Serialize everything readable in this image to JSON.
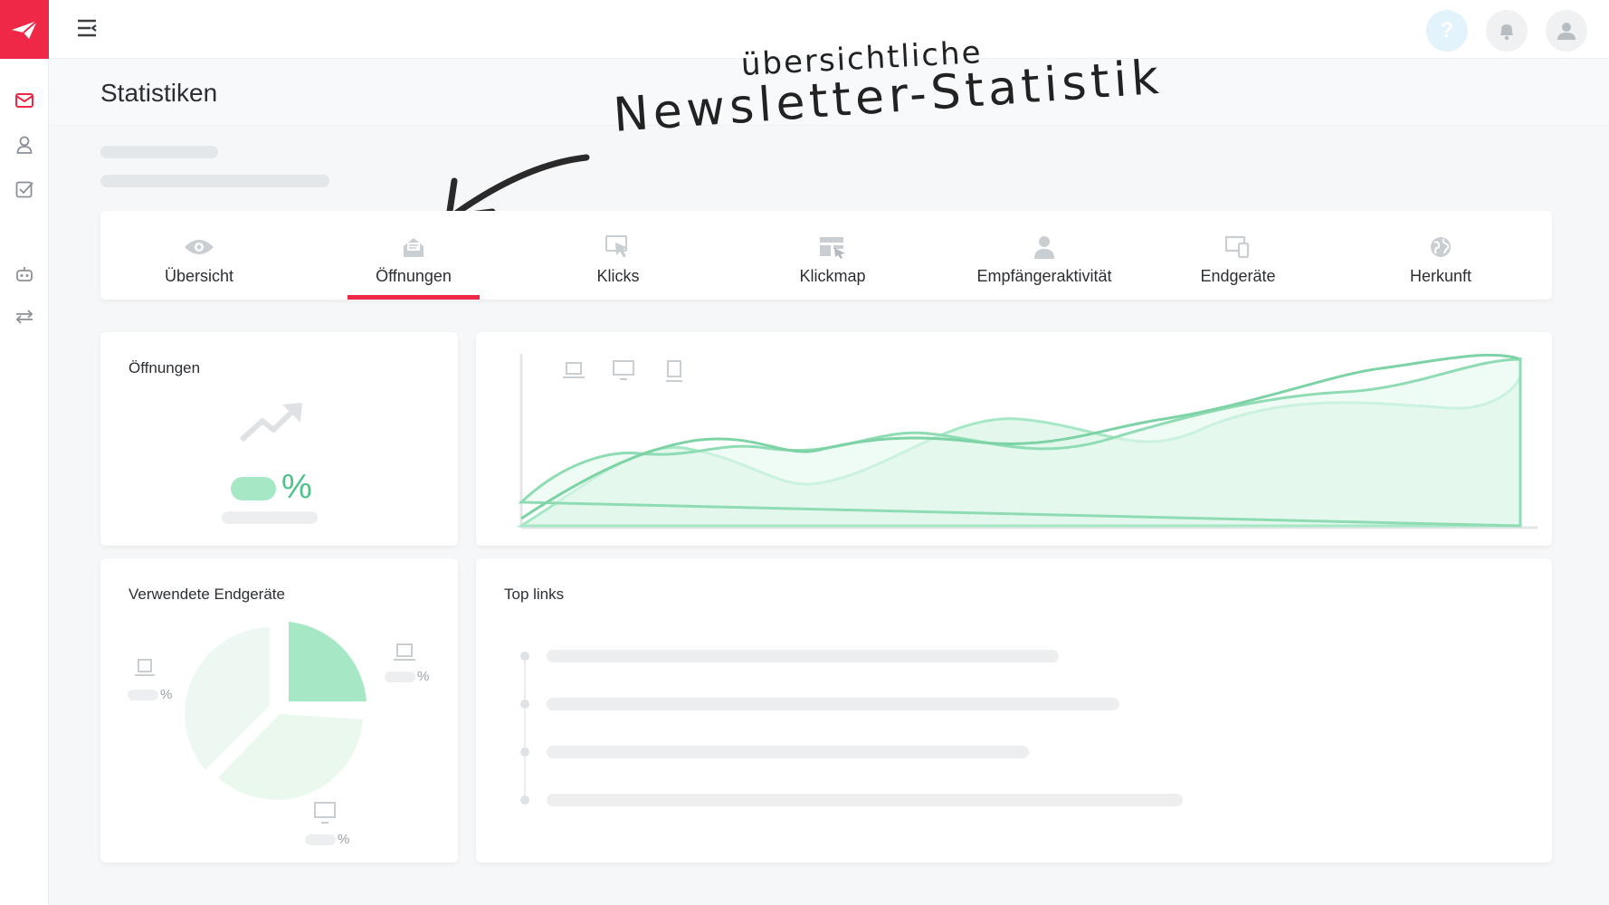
{
  "page": {
    "title": "Statistiken"
  },
  "annotation": {
    "line1": "übersichtliche",
    "line2": "Newsletter-Statistik"
  },
  "tabs": [
    {
      "label": "Übersicht",
      "icon": "eye-icon"
    },
    {
      "label": "Öffnungen",
      "icon": "open-mail-icon",
      "active": true
    },
    {
      "label": "Klicks",
      "icon": "cursor-click-icon"
    },
    {
      "label": "Klickmap",
      "icon": "klickmap-icon"
    },
    {
      "label": "Empfängeraktivität",
      "icon": "person-icon"
    },
    {
      "label": "Endgeräte",
      "icon": "devices-icon"
    },
    {
      "label": "Herkunft",
      "icon": "globe-icon"
    }
  ],
  "opens_card": {
    "title": "Öffnungen",
    "percent_symbol": "%"
  },
  "devices_card": {
    "title": "Verwendete Endgeräte",
    "pct": "%"
  },
  "links_card": {
    "title": "Top links"
  },
  "top_help": "?",
  "colors": {
    "brand": "#ef2848",
    "green": "#4cc38a",
    "green_light": "#a6e8c6"
  }
}
